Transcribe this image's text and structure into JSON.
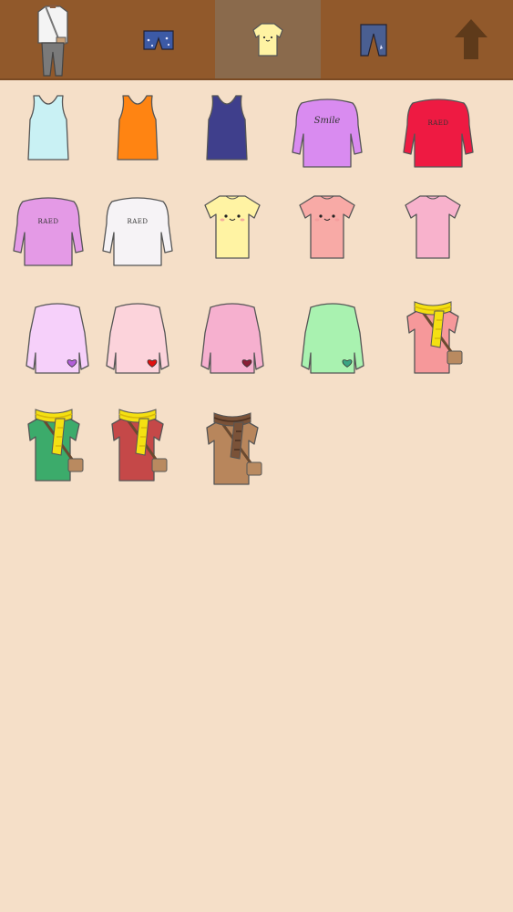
{
  "tabs": [
    {
      "id": "outfit",
      "icon": "full-outfit-icon",
      "selected": false
    },
    {
      "id": "bottoms",
      "icon": "shorts-icon",
      "selected": false
    },
    {
      "id": "tops",
      "icon": "tshirt-icon",
      "selected": true
    },
    {
      "id": "pants",
      "icon": "jeans-icon",
      "selected": false
    },
    {
      "id": "up",
      "icon": "up-arrow-icon",
      "selected": false
    }
  ],
  "colors": {
    "topbar": "#91592b",
    "tab_selected": "#8a6a4c",
    "background": "#f5dfc8",
    "arrow": "#5e3a1a"
  },
  "items": [
    {
      "type": "tank",
      "color": "#c9f1f4",
      "icon": "tank-top-icon"
    },
    {
      "type": "tank",
      "color": "#ff8412",
      "icon": "tank-top-icon"
    },
    {
      "type": "tank",
      "color": "#3f3f8c",
      "icon": "tank-top-icon"
    },
    {
      "type": "offshoulder",
      "color": "#d98bf0",
      "icon": "off-shoulder-sweater-icon",
      "text": "Smile"
    },
    {
      "type": "offshoulder",
      "color": "#ee1a42",
      "icon": "off-shoulder-sweater-icon",
      "text": "RAED"
    },
    {
      "type": "offshoulder",
      "color": "#e49ae6",
      "icon": "off-shoulder-sweater-icon",
      "text": "RAED"
    },
    {
      "type": "offshoulder",
      "color": "#f6f3f6",
      "icon": "off-shoulder-sweater-icon",
      "text": "RAED"
    },
    {
      "type": "tee",
      "color": "#fff3a3",
      "icon": "kawaii-tshirt-icon",
      "face": true
    },
    {
      "type": "tee",
      "color": "#f8aaa6",
      "icon": "kawaii-tshirt-icon",
      "face": true
    },
    {
      "type": "tee",
      "color": "#f8b2cc",
      "icon": "tshirt-icon",
      "face": false
    },
    {
      "type": "sweater",
      "color": "#f6d0fa",
      "icon": "heart-sweater-icon",
      "heart": "#b15ed8"
    },
    {
      "type": "sweater",
      "color": "#fcd3db",
      "icon": "heart-sweater-icon",
      "heart": "#e01010"
    },
    {
      "type": "sweater",
      "color": "#f6b0cf",
      "icon": "heart-sweater-icon",
      "heart": "#8a1f36"
    },
    {
      "type": "sweater",
      "color": "#a9f2b0",
      "icon": "heart-sweater-icon",
      "heart": "#3aa583"
    },
    {
      "type": "scarfbag",
      "color": "#f6989a",
      "scarf": "#f4e012",
      "scarf_dark": "#d8b80a",
      "icon": "scarf-bag-shirt-icon"
    },
    {
      "type": "scarfbag",
      "color": "#3cab6b",
      "scarf": "#f4e012",
      "scarf_dark": "#d8b80a",
      "icon": "scarf-bag-shirt-icon"
    },
    {
      "type": "scarfbag",
      "color": "#c54848",
      "scarf": "#f4e012",
      "scarf_dark": "#d8b80a",
      "icon": "scarf-bag-shirt-icon"
    },
    {
      "type": "scarfbag",
      "color": "#b8865c",
      "scarf": "#7a5238",
      "scarf_dark": "#4b3020",
      "icon": "scarf-bag-shirt-icon"
    }
  ]
}
